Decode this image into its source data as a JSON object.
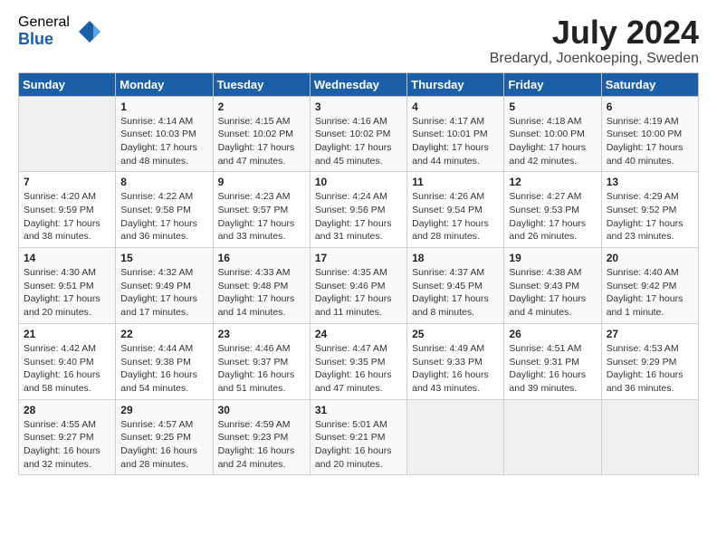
{
  "logo": {
    "general": "General",
    "blue": "Blue"
  },
  "title": "July 2024",
  "location": "Bredaryd, Joenkoeping, Sweden",
  "headers": [
    "Sunday",
    "Monday",
    "Tuesday",
    "Wednesday",
    "Thursday",
    "Friday",
    "Saturday"
  ],
  "weeks": [
    [
      {
        "day": "",
        "info": ""
      },
      {
        "day": "1",
        "info": "Sunrise: 4:14 AM\nSunset: 10:03 PM\nDaylight: 17 hours\nand 48 minutes."
      },
      {
        "day": "2",
        "info": "Sunrise: 4:15 AM\nSunset: 10:02 PM\nDaylight: 17 hours\nand 47 minutes."
      },
      {
        "day": "3",
        "info": "Sunrise: 4:16 AM\nSunset: 10:02 PM\nDaylight: 17 hours\nand 45 minutes."
      },
      {
        "day": "4",
        "info": "Sunrise: 4:17 AM\nSunset: 10:01 PM\nDaylight: 17 hours\nand 44 minutes."
      },
      {
        "day": "5",
        "info": "Sunrise: 4:18 AM\nSunset: 10:00 PM\nDaylight: 17 hours\nand 42 minutes."
      },
      {
        "day": "6",
        "info": "Sunrise: 4:19 AM\nSunset: 10:00 PM\nDaylight: 17 hours\nand 40 minutes."
      }
    ],
    [
      {
        "day": "7",
        "info": "Sunrise: 4:20 AM\nSunset: 9:59 PM\nDaylight: 17 hours\nand 38 minutes."
      },
      {
        "day": "8",
        "info": "Sunrise: 4:22 AM\nSunset: 9:58 PM\nDaylight: 17 hours\nand 36 minutes."
      },
      {
        "day": "9",
        "info": "Sunrise: 4:23 AM\nSunset: 9:57 PM\nDaylight: 17 hours\nand 33 minutes."
      },
      {
        "day": "10",
        "info": "Sunrise: 4:24 AM\nSunset: 9:56 PM\nDaylight: 17 hours\nand 31 minutes."
      },
      {
        "day": "11",
        "info": "Sunrise: 4:26 AM\nSunset: 9:54 PM\nDaylight: 17 hours\nand 28 minutes."
      },
      {
        "day": "12",
        "info": "Sunrise: 4:27 AM\nSunset: 9:53 PM\nDaylight: 17 hours\nand 26 minutes."
      },
      {
        "day": "13",
        "info": "Sunrise: 4:29 AM\nSunset: 9:52 PM\nDaylight: 17 hours\nand 23 minutes."
      }
    ],
    [
      {
        "day": "14",
        "info": "Sunrise: 4:30 AM\nSunset: 9:51 PM\nDaylight: 17 hours\nand 20 minutes."
      },
      {
        "day": "15",
        "info": "Sunrise: 4:32 AM\nSunset: 9:49 PM\nDaylight: 17 hours\nand 17 minutes."
      },
      {
        "day": "16",
        "info": "Sunrise: 4:33 AM\nSunset: 9:48 PM\nDaylight: 17 hours\nand 14 minutes."
      },
      {
        "day": "17",
        "info": "Sunrise: 4:35 AM\nSunset: 9:46 PM\nDaylight: 17 hours\nand 11 minutes."
      },
      {
        "day": "18",
        "info": "Sunrise: 4:37 AM\nSunset: 9:45 PM\nDaylight: 17 hours\nand 8 minutes."
      },
      {
        "day": "19",
        "info": "Sunrise: 4:38 AM\nSunset: 9:43 PM\nDaylight: 17 hours\nand 4 minutes."
      },
      {
        "day": "20",
        "info": "Sunrise: 4:40 AM\nSunset: 9:42 PM\nDaylight: 17 hours\nand 1 minute."
      }
    ],
    [
      {
        "day": "21",
        "info": "Sunrise: 4:42 AM\nSunset: 9:40 PM\nDaylight: 16 hours\nand 58 minutes."
      },
      {
        "day": "22",
        "info": "Sunrise: 4:44 AM\nSunset: 9:38 PM\nDaylight: 16 hours\nand 54 minutes."
      },
      {
        "day": "23",
        "info": "Sunrise: 4:46 AM\nSunset: 9:37 PM\nDaylight: 16 hours\nand 51 minutes."
      },
      {
        "day": "24",
        "info": "Sunrise: 4:47 AM\nSunset: 9:35 PM\nDaylight: 16 hours\nand 47 minutes."
      },
      {
        "day": "25",
        "info": "Sunrise: 4:49 AM\nSunset: 9:33 PM\nDaylight: 16 hours\nand 43 minutes."
      },
      {
        "day": "26",
        "info": "Sunrise: 4:51 AM\nSunset: 9:31 PM\nDaylight: 16 hours\nand 39 minutes."
      },
      {
        "day": "27",
        "info": "Sunrise: 4:53 AM\nSunset: 9:29 PM\nDaylight: 16 hours\nand 36 minutes."
      }
    ],
    [
      {
        "day": "28",
        "info": "Sunrise: 4:55 AM\nSunset: 9:27 PM\nDaylight: 16 hours\nand 32 minutes."
      },
      {
        "day": "29",
        "info": "Sunrise: 4:57 AM\nSunset: 9:25 PM\nDaylight: 16 hours\nand 28 minutes."
      },
      {
        "day": "30",
        "info": "Sunrise: 4:59 AM\nSunset: 9:23 PM\nDaylight: 16 hours\nand 24 minutes."
      },
      {
        "day": "31",
        "info": "Sunrise: 5:01 AM\nSunset: 9:21 PM\nDaylight: 16 hours\nand 20 minutes."
      },
      {
        "day": "",
        "info": ""
      },
      {
        "day": "",
        "info": ""
      },
      {
        "day": "",
        "info": ""
      }
    ]
  ]
}
